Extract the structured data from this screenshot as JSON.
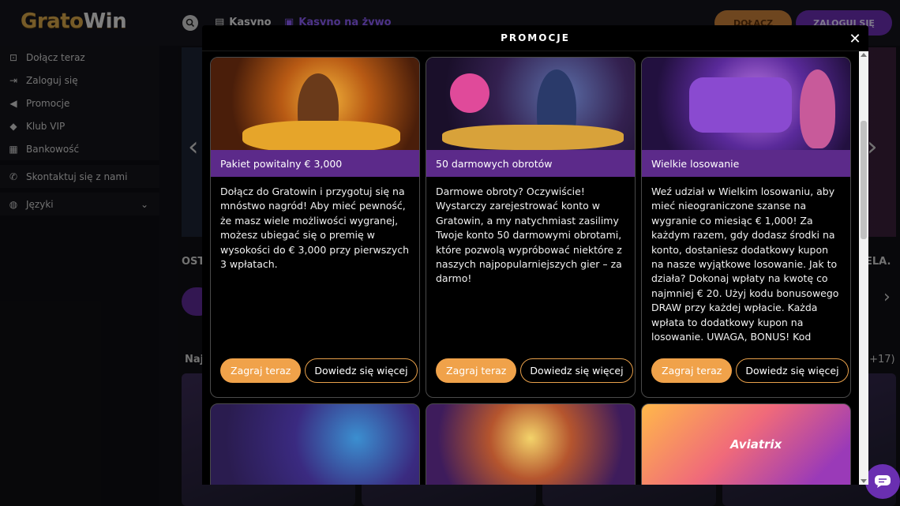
{
  "header": {
    "logo_text_a": "Grato",
    "logo_text_b": "Win",
    "tabs": [
      {
        "label": "Kasyno",
        "icon": "slot-machine-icon"
      },
      {
        "label": "Kasyno na żywo",
        "icon": "live-cards-icon"
      }
    ],
    "join_label": "DOŁĄCZ",
    "login_label": "ZALOGUJ SIĘ"
  },
  "sidebar": {
    "items": [
      {
        "label": "Dołącz teraz",
        "icon": "join-icon"
      },
      {
        "label": "Zaloguj się",
        "icon": "login-icon"
      },
      {
        "label": "Promocje",
        "icon": "megaphone-icon"
      },
      {
        "label": "Klub VIP",
        "icon": "diamond-icon"
      },
      {
        "label": "Bankowość",
        "icon": "bank-icon"
      },
      {
        "label": "Skontaktuj się z nami",
        "icon": "phone-icon"
      },
      {
        "label": "Języki",
        "icon": "globe-icon"
      }
    ]
  },
  "background": {
    "section_left": "OST",
    "section_right": "ELA.",
    "row_label": "Naj",
    "count": "(+17)"
  },
  "modal": {
    "title": "PROMOCJE",
    "close": "✕",
    "cards": [
      {
        "title": "Pakiet powitalny € 3,000",
        "body": "Dołącz do Gratowin i przygotuj się na mnóstwo nagród! Aby mieć pewność, że masz wiele możliwości wygranej, możesz ubiegać się o premię w wysokości do € 3,000 przy pierwszych 3 wpłatach.",
        "play": "Zagraj teraz",
        "more": "Dowiedz się więcej"
      },
      {
        "title": "50 darmowych obrotów",
        "body": "Darmowe obroty? Oczywiście! Wystarczy zarejestrować konto w Gratowin, a my natychmiast zasilimy Twoje konto 50 darmowymi obrotami, które pozwolą wypróbować niektóre z naszych najpopularniejszych gier – za darmo!",
        "play": "Zagraj teraz",
        "more": "Dowiedz się więcej"
      },
      {
        "title": "Wielkie losowanie",
        "body": "Weź udział w Wielkim losowaniu, aby mieć nieograniczone szanse na wygranie co miesiąc € 1,000! Za każdym razem, gdy dodasz środki na konto, dostaniesz dodatkowy kupon na nasze wyjątkowe losowanie.  Jak to działa? Dokonaj wpłaty na kwotę co najmniej € 20. Użyj kodu bonusowego DRAW przy każdej wpłacie. Każda wpłata to dodatkowy kupon na losowanie. UWAGA, BONUS! Kod",
        "play": "Zagraj teraz",
        "more": "Dowiedz się więcej"
      }
    ],
    "second_row_logo": "Aviatrix"
  },
  "colors": {
    "accent_orange": "#f0a24a",
    "accent_purple": "#5c2a8a"
  }
}
